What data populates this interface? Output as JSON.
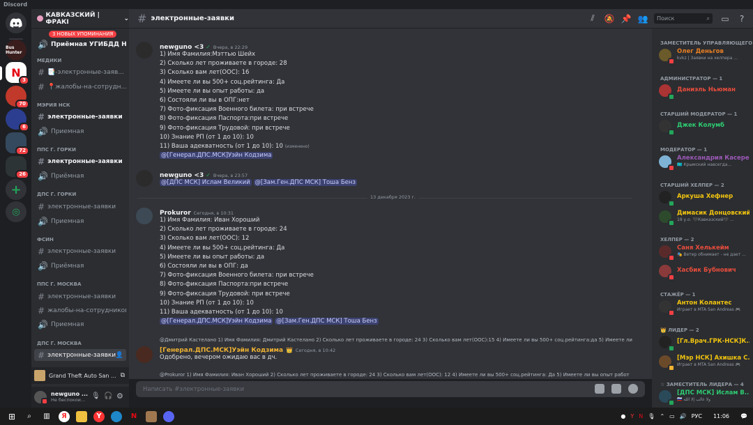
{
  "window": {
    "title": "Discord"
  },
  "rail": {
    "servers": [
      {
        "label": "Bus Hunter",
        "badge": ""
      },
      {
        "label": "N",
        "badge": "3"
      },
      {
        "label": "",
        "badge": "70"
      },
      {
        "label": "",
        "badge": "6"
      },
      {
        "label": "",
        "badge": "72"
      },
      {
        "label": "",
        "badge": "26"
      }
    ]
  },
  "sidebar": {
    "guild_name": "КАВКАЗСКИЙ | ФРАКІ",
    "mentions_pill": "3 НОВЫХ УПОМИНАНИЯ",
    "top_channel": "Приёмная УГИБДД НСК",
    "categories": [
      {
        "name": "МЕДИКИ",
        "channels": [
          {
            "name": "📑-электронные-заяв...",
            "type": "text"
          },
          {
            "name": "📍жалобы-на-сотрудн...",
            "type": "text"
          }
        ]
      },
      {
        "name": "МЭРИЯ НСК",
        "channels": [
          {
            "name": "электронные-заявки",
            "type": "text",
            "unread": true
          },
          {
            "name": "Приемная",
            "type": "voice"
          }
        ]
      },
      {
        "name": "ППС Г. ГОРКИ",
        "channels": [
          {
            "name": "электронные-заявки",
            "type": "text",
            "unread": true
          },
          {
            "name": "Приёмная",
            "type": "voice"
          }
        ]
      },
      {
        "name": "ДПС Г. ГОРКИ",
        "channels": [
          {
            "name": "электронные-заявки",
            "type": "text"
          },
          {
            "name": "Приемная",
            "type": "voice"
          }
        ]
      },
      {
        "name": "ФСИН",
        "channels": [
          {
            "name": "электронные-заявки",
            "type": "text"
          },
          {
            "name": "Приёмная",
            "type": "voice"
          }
        ]
      },
      {
        "name": "ППС Г. МОСКВА",
        "channels": [
          {
            "name": "электронные-заявки",
            "type": "text"
          },
          {
            "name": "жалобы-на-сотрудников",
            "type": "text"
          },
          {
            "name": "Приемная",
            "type": "voice"
          }
        ]
      },
      {
        "name": "ДПС Г. МОСКВА",
        "channels": [
          {
            "name": "электронные-заявки",
            "type": "text",
            "active": true
          }
        ]
      }
    ],
    "activity": "Grand Theft Auto San ...",
    "user": {
      "name": "newguno ...",
      "status": "Не беспокои..."
    }
  },
  "topbar": {
    "channel": "электронные-заявки",
    "search_placeholder": "Поиск"
  },
  "messages": [
    {
      "author": "newguno <3",
      "time": "Вчера, в 22:29",
      "lines": [
        "1) Имя Фамилия:Мэттью Шейх",
        "2) Сколько лет проживаете в городе:  28",
        "3) Сколько вам лет(ООС): 16",
        "4) Имеете ли вы 500+ соц.рейтинга: Да",
        "5) Имеете ли вы опыт работы: да",
        "6) Состояли ли вы в ОПГ:нет",
        "7) Фото-фиксация Военного билета: при встрече",
        "8) Фото-фиксация Паспорта:при встрече",
        "9) Фото-фиксация Трудовой: при встрече",
        "10) Знание РП (от 1 до 10):  10",
        "11) Ваша адекватность (от 1 до 10):  10"
      ],
      "edited": "(изменено)",
      "mention": "@[Генерал.ДПС.МСК]Уэйн Кодзима"
    },
    {
      "author": "newguno <3",
      "time": "Вчера, в 23:57",
      "mention1": "@[ДПС МСК] Ислам Великий",
      "mention2": "@[Зам.Ген.ДПС МСК] Тоша Бенз"
    },
    {
      "author": "Prokuror",
      "time": "Сегодня, в 10:31",
      "lines": [
        "1) Имя Фамилия: Иван Хороший",
        "2) Сколько лет проживаете в городе:  24",
        "3) Сколько вам лет(ООС): 12",
        "4) Имеете ли вы 500+ соц.рейтинга: Да",
        "5) Имеете ли вы опыт работы: да",
        "6) Состояли ли вы в ОПГ: да",
        "7) Фото-фиксация Военного билета: при встрече",
        "8) Фото-фиксация Паспорта:при встрече",
        "9) Фото-фиксация Трудовой: при встрече",
        "10) Знание РП (от 1 до 10):  10",
        "11) Ваша адекватность (от 1 до 10):  10"
      ],
      "mention1": "@[Генерал.ДПС.МСК]Уэйн Кодзима",
      "mention2": "@[Зам.Ген.ДПС МСК] Тоша Бенз"
    },
    {
      "reply": "@Дмитрий Кастелано  1) Имя Фамилия: Дмитрий Кастелано 2) Сколько лет проживаете в городе: 24 3) Сколько вам лет(ООС):15 4) Имеете ли вы 500+ соц.рейтинга:да 5) Имеете ли",
      "author": "[Генерал.ДПС.МСК]Уэйн Кодзима",
      "crown": "👑",
      "time": "Сегодня, в 10:42",
      "text": "Одобрено, вечером ожидаю вас в дч."
    },
    {
      "reply": "@Prokuror  1) Имя Фамилия: Иван Хороший 2) Сколько лет проживаете в городе: 24 3) Сколько вам лет(ООС): 12 4) Имеете ли вы 500+ соц.рейтинга: Да 5) Имеете ли вы опыт работ"
    }
  ],
  "date_divider": "13 декабря 2023 г.",
  "composer": {
    "placeholder": "Написать #электронные-заявки"
  },
  "members": [
    {
      "category": "ЗАМЕСТИТЕЛЬ УПРАВЛЯЮЩЕГО ...",
      "items": [
        {
          "name": "Олег Деньгов",
          "sub": "kvkz | Заявки на хелпера ...",
          "color": "#e67e22",
          "status": "dnd"
        }
      ]
    },
    {
      "category": "АДМИНИСТРАТОР — 1",
      "items": [
        {
          "name": "Даниэль Ньюман",
          "sub": "",
          "color": "#e74c3c",
          "status": "online"
        }
      ]
    },
    {
      "category": "СТАРШИЙ МОДЕРАТОР — 1",
      "items": [
        {
          "name": "Джек Колумб",
          "sub": "",
          "color": "#2ecc71",
          "status": "online"
        }
      ]
    },
    {
      "category": "МОДЕРАТОР — 1",
      "items": [
        {
          "name": "Александрия Касерез",
          "sub": "🇰🇿 Крымский навсегда...",
          "color": "#9b59b6",
          "status": "dnd"
        }
      ]
    },
    {
      "category": "СТАРШИЙ ХЕЛПЕР — 2",
      "items": [
        {
          "name": "Аркуша Хефнер",
          "sub": "",
          "color": "#f1c40f",
          "status": "online"
        },
        {
          "name": "Димасик Донцовский",
          "sub": "18 у.о. 🖤Кавказский🖤 ...",
          "color": "#f1c40f",
          "status": "online"
        }
      ]
    },
    {
      "category": "ХЕЛПЕР — 2",
      "items": [
        {
          "name": "Саня Хелькейм",
          "sub": "🎭 Ветер обнимает - не дает ...",
          "color": "#e74c3c",
          "status": "dnd"
        },
        {
          "name": "Хасбик Бубнович",
          "sub": "",
          "color": "#e74c3c",
          "status": "dnd"
        }
      ]
    },
    {
      "category": "СТАЖЁР — 1",
      "items": [
        {
          "name": "Антон Колантес",
          "sub": "Играет в MTA San Andreas 🎮",
          "color": "#f1c40f",
          "status": "online"
        }
      ]
    },
    {
      "category": "👑 ЛИДЕР — 2",
      "items": [
        {
          "name": "[Гл.Врач.ГРК-НСК]К...",
          "sub": "",
          "color": "#f1c40f",
          "status": "online"
        },
        {
          "name": "[Мэр НСК] Ахишка С...",
          "sub": "Играет в MTA San Andreas 🎮",
          "color": "#f1c40f",
          "status": "online"
        }
      ]
    },
    {
      "category": "☆ ЗАМЕСТИТЕЛЬ ЛИДЕРА — 4",
      "items": [
        {
          "name": "[ДПС МСК] Ислам В...",
          "sub": "🇷🇺 ولا غالب إلا الله",
          "color": "#2ecc71",
          "status": "online"
        }
      ]
    }
  ],
  "taskbar": {
    "lang": "РУС",
    "time": "11:06"
  }
}
